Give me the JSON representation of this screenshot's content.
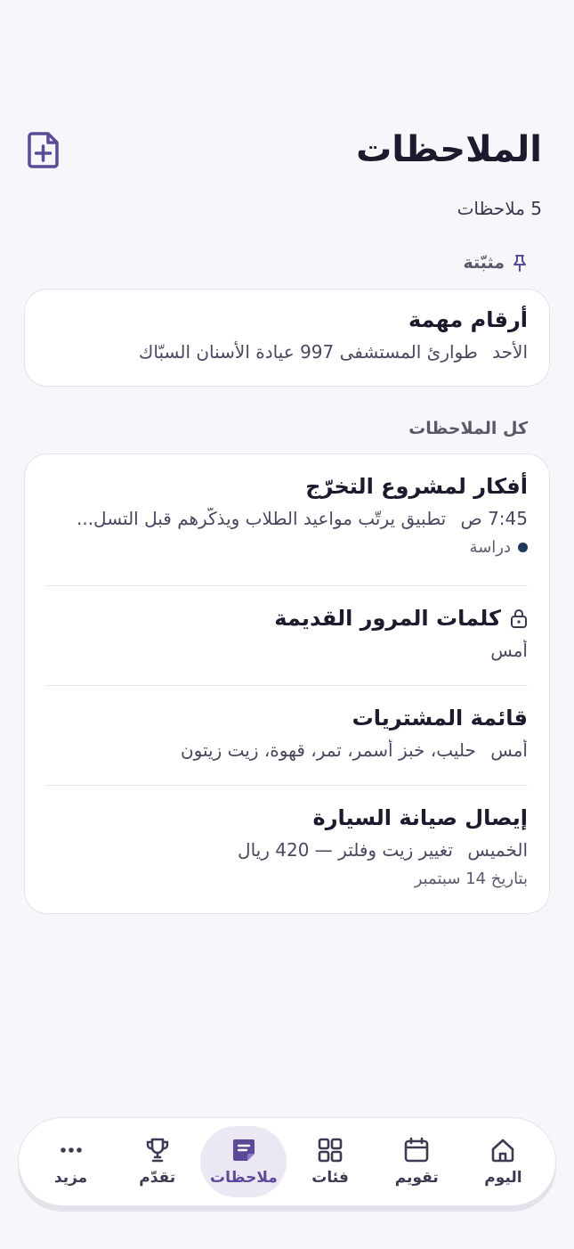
{
  "header": {
    "title": "الملاحظات",
    "new_note_icon": "file-plus-icon"
  },
  "summary": {
    "count": "5 ملاحظات"
  },
  "pinned": {
    "label": "مثبّتة",
    "icon": "pin-icon",
    "notes": [
      {
        "title": "أرقام مهمة",
        "time": "الأحد",
        "preview": "طوارئ المستشفى 997 عيادة الأسنان السبّاك"
      }
    ]
  },
  "all_notes": {
    "label": "كل الملاحظات",
    "notes": [
      {
        "title": "أفكار لمشروع التخرّج",
        "time": "7:45 ص",
        "preview": "تطبيق يرتّب مواعيد الطلاب ويذكّرهم قبل التسل...",
        "tag": "دراسة",
        "tag_color": "#1e3b5a"
      },
      {
        "title": "كلمات المرور القديمة",
        "time": "أمس",
        "locked": true,
        "icon": "lock-icon"
      },
      {
        "title": "قائمة المشتريات",
        "time": "أمس",
        "preview": "حليب، خبز أسمر، تمر، قهوة، زيت زيتون"
      },
      {
        "title": "إيصال صيانة السيارة",
        "time": "الخميس",
        "preview": "تغيير زيت وفلتر — 420 ريال",
        "extra": "بتاريخ 14 سبتمبر"
      }
    ]
  },
  "tabbar": {
    "active": "notes",
    "accent": "#5b4a97",
    "tabs": [
      {
        "id": "today",
        "label": "اليوم",
        "icon": "home-icon"
      },
      {
        "id": "calendar",
        "label": "تقويم",
        "icon": "calendar-icon"
      },
      {
        "id": "categories",
        "label": "فئات",
        "icon": "grid-icon"
      },
      {
        "id": "notes",
        "label": "ملاحظات",
        "icon": "note-icon"
      },
      {
        "id": "progress",
        "label": "تقدّم",
        "icon": "trophy-icon"
      },
      {
        "id": "more",
        "label": "مزيد",
        "icon": "more-dots-icon"
      }
    ]
  }
}
